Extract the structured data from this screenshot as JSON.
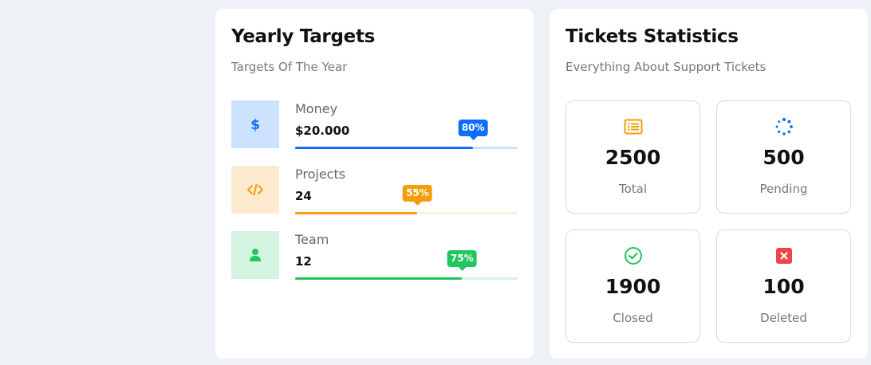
{
  "targets_card": {
    "title": "Yearly Targets",
    "subtitle": "Targets Of The Year",
    "items": [
      {
        "label": "Money",
        "value": "$20.000",
        "percent_label": "80%",
        "progress": 0.8,
        "icon": "dollar-icon",
        "color": "#0d6efd",
        "tile_bg": "#cce2fe",
        "track_bg": "#cce2fe"
      },
      {
        "label": "Projects",
        "value": "24",
        "percent_label": "55%",
        "progress": 0.55,
        "icon": "code-icon",
        "color": "#f59e0b",
        "tile_bg": "#fdebd0",
        "track_bg": "#fbf0d9"
      },
      {
        "label": "Team",
        "value": "12",
        "percent_label": "75%",
        "progress": 0.75,
        "icon": "user-icon",
        "color": "#22c55e",
        "tile_bg": "#d3f4e0",
        "track_bg": "#d8f3e2"
      }
    ]
  },
  "tickets_card": {
    "title": "Tickets Statistics",
    "subtitle": "Everything About Support Tickets",
    "items": [
      {
        "number": "2500",
        "label": "Total",
        "icon": "list-icon",
        "color": "#f59e0b"
      },
      {
        "number": "500",
        "label": "Pending",
        "icon": "spinner-icon",
        "color": "#0d6efd"
      },
      {
        "number": "1900",
        "label": "Closed",
        "icon": "check-circle-icon",
        "color": "#22c55e"
      },
      {
        "number": "100",
        "label": "Deleted",
        "icon": "x-square-icon",
        "color": "#ef4444"
      }
    ]
  }
}
